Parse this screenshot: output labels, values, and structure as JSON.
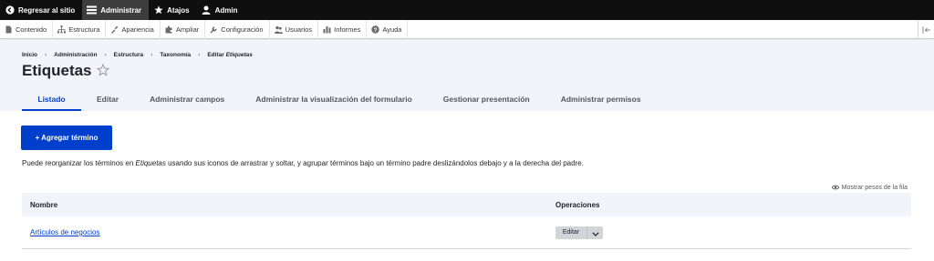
{
  "toolbar": {
    "back_label": "Regresar al sitio",
    "manage_label": "Administrar",
    "shortcuts_label": "Atajos",
    "user_label": "Admin"
  },
  "tray": {
    "items": [
      {
        "label": "Contenido",
        "icon": "content-icon"
      },
      {
        "label": "Estructura",
        "icon": "structure-icon"
      },
      {
        "label": "Apariencia",
        "icon": "appearance-icon"
      },
      {
        "label": "Ampliar",
        "icon": "extend-icon"
      },
      {
        "label": "Configuración",
        "icon": "wrench-icon"
      },
      {
        "label": "Usuarios",
        "icon": "people-icon"
      },
      {
        "label": "Informes",
        "icon": "reports-icon"
      },
      {
        "label": "Ayuda",
        "icon": "help-icon"
      }
    ]
  },
  "breadcrumb": {
    "items": [
      "Inicio",
      "Administración",
      "Estructura",
      "Taxonomía"
    ],
    "current_prefix": "Editar",
    "current_em": "Etiquetas"
  },
  "page": {
    "title": "Etiquetas"
  },
  "tabs": [
    "Listado",
    "Editar",
    "Administrar campos",
    "Administrar la visualización del formulario",
    "Gestionar presentación",
    "Administrar permisos"
  ],
  "actions": {
    "add_term": "+ Agregar término"
  },
  "description": {
    "before": "Puede reorganizar los términos en ",
    "em": "Etiquetas",
    "after": " usando sus iconos de arrastrar y soltar, y agrupar términos bajo un término padre deslizándolos debajo y a la derecha del padre."
  },
  "weights_link": "Mostrar pesos de la fila",
  "table": {
    "headers": {
      "name": "Nombre",
      "operations": "Operaciones"
    },
    "rows": [
      {
        "name": "Artículos de negocios",
        "operation": "Editar"
      }
    ]
  },
  "colors": {
    "accent": "#003ecc",
    "toolbar_bg": "#0f0f0f",
    "header_bg": "#f3f4f9"
  }
}
